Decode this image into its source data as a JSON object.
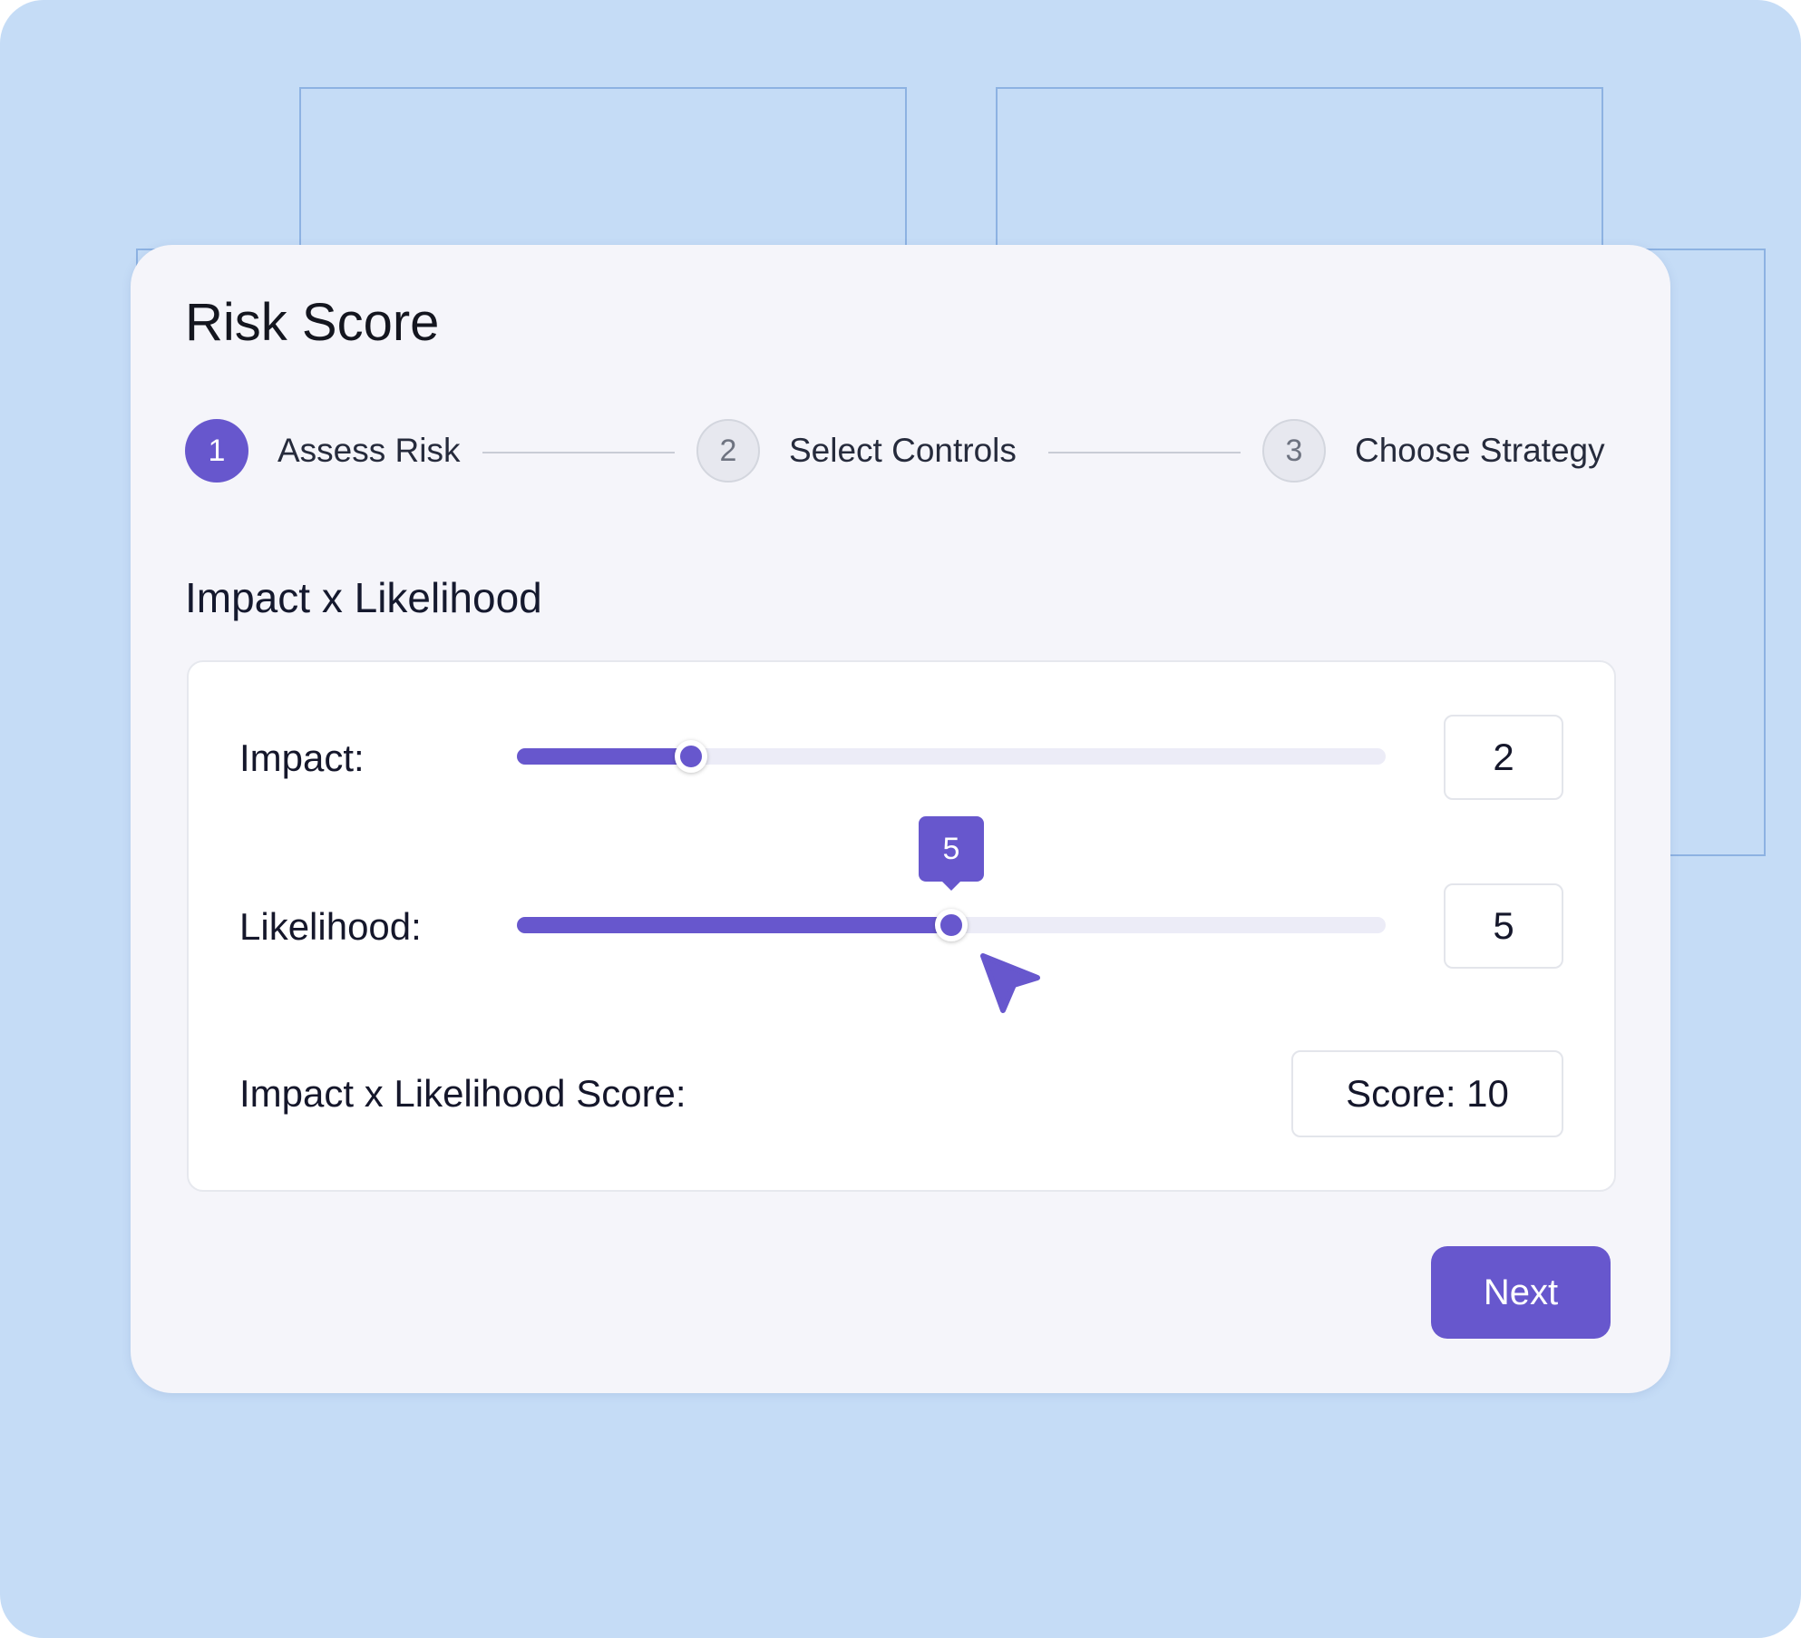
{
  "colors": {
    "accent": "#6757cd",
    "background": "#c5dcf6",
    "card": "#f5f5fa",
    "track": "#ececf7"
  },
  "card": {
    "title": "Risk Score"
  },
  "stepper": {
    "steps": [
      {
        "number": "1",
        "label": "Assess Risk",
        "state": "active"
      },
      {
        "number": "2",
        "label": "Select Controls",
        "state": "inactive"
      },
      {
        "number": "3",
        "label": "Choose Strategy",
        "state": "inactive"
      }
    ]
  },
  "section": {
    "title": "Impact x Likelihood"
  },
  "impact": {
    "label": "Impact:",
    "value": "2",
    "slider_fraction": 0.2
  },
  "likelihood": {
    "label": "Likelihood:",
    "value": "5",
    "tooltip": "5",
    "slider_fraction": 0.5
  },
  "score": {
    "label": "Impact x Likelihood Score:",
    "value": "Score: 10"
  },
  "actions": {
    "next_label": "Next"
  },
  "cursor_icon": "pointer-arrow-icon"
}
